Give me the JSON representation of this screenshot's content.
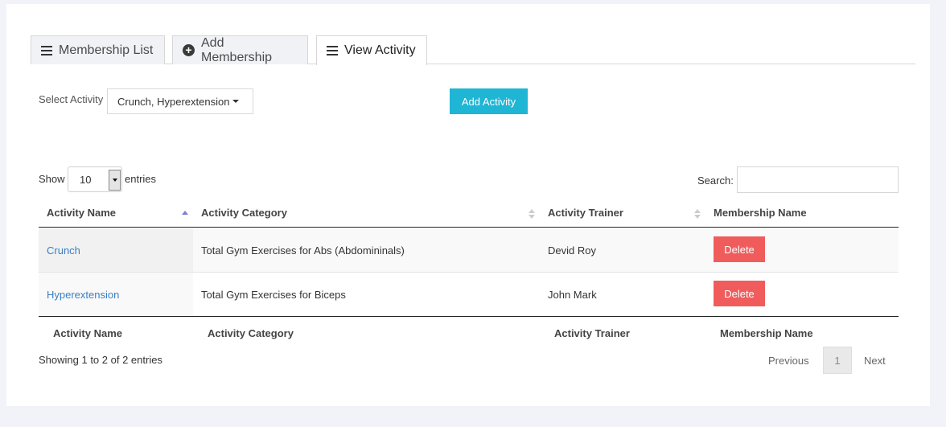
{
  "tabs": [
    {
      "label": "Membership List",
      "icon": "list-icon"
    },
    {
      "label": "Add Membership",
      "icon": "plus-circle-icon"
    },
    {
      "label": "View Activity",
      "icon": "list-icon",
      "active": true
    }
  ],
  "activity_select": {
    "label": "Select Activity",
    "value": "Crunch, Hyperextension"
  },
  "add_activity_button": "Add Activity",
  "length_control": {
    "show_label": "Show",
    "value": "10",
    "entries_label": "entries"
  },
  "search": {
    "label": "Search:",
    "value": ""
  },
  "table": {
    "columns": [
      "Activity Name",
      "Activity Category",
      "Activity Trainer",
      "Membership Name"
    ],
    "rows": [
      {
        "name": "Crunch",
        "category": "Total Gym Exercises for Abs (Abdomininals)",
        "trainer": "Devid Roy",
        "action": "Delete"
      },
      {
        "name": "Hyperextension",
        "category": "Total Gym Exercises for Biceps",
        "trainer": "John Mark",
        "action": "Delete"
      }
    ],
    "footer_columns": [
      "Activity Name",
      "Activity Category",
      "Activity Trainer",
      "Membership Name"
    ]
  },
  "info": "Showing 1 to 2 of 2 entries",
  "pagination": {
    "previous": "Previous",
    "current": "1",
    "next": "Next"
  },
  "colors": {
    "accent": "#1fb5d4",
    "danger": "#f05c5c",
    "link": "#3a7fc1",
    "background": "#f1f3f8"
  }
}
